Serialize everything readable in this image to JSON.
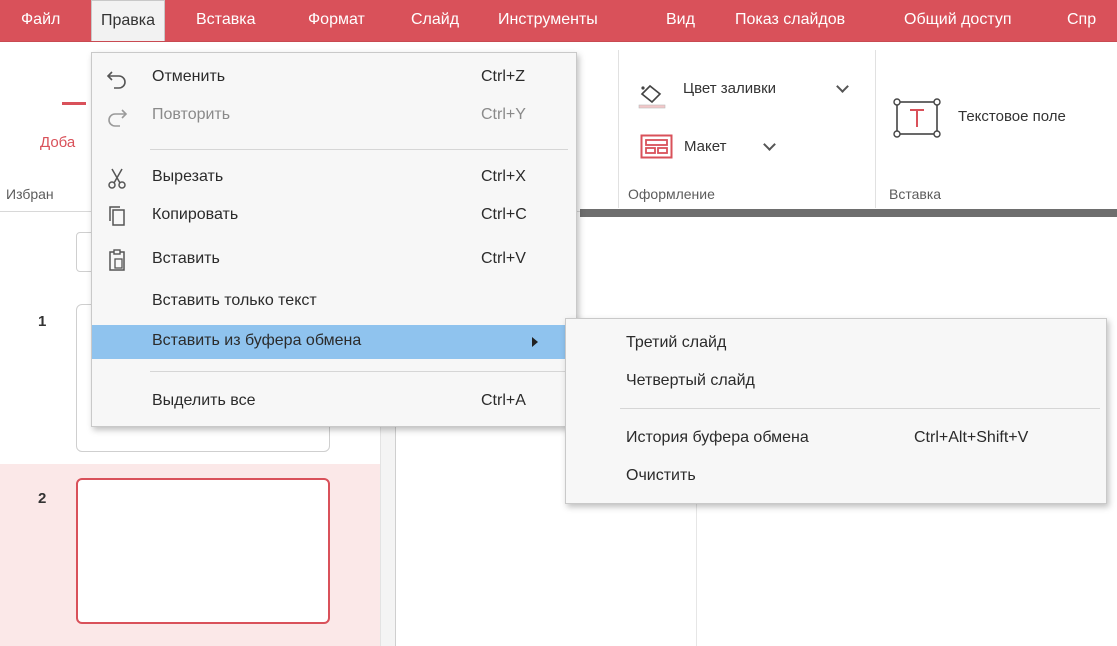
{
  "menubar": {
    "items": [
      "Файл",
      "Правка",
      "Вставка",
      "Формат",
      "Слайд",
      "Инструменты",
      "Вид",
      "Показ слайдов",
      "Общий доступ",
      "Спр"
    ],
    "active": "Правка"
  },
  "ribbon": {
    "favorites_button_label": "Доба",
    "favorites_group_label": "Избран",
    "fill_color_label": "Цвет заливки",
    "layout_label": "Макет",
    "design_group_label": "Оформление",
    "text_box_label": "Текстовое поле",
    "insert_group_label": "Вставка"
  },
  "slides": {
    "numbers": [
      "1",
      "2"
    ],
    "selected": "2"
  },
  "edit_menu": {
    "items": [
      {
        "label": "Отменить",
        "shortcut": "Ctrl+Z",
        "icon": "undo-icon"
      },
      {
        "label": "Повторить",
        "shortcut": "Ctrl+Y",
        "icon": "redo-icon"
      },
      {
        "label": "Вырезать",
        "shortcut": "Ctrl+X",
        "icon": "scissors-icon"
      },
      {
        "label": "Копировать",
        "shortcut": "Ctrl+C",
        "icon": "copy-icon"
      },
      {
        "label": "Вставить",
        "shortcut": "Ctrl+V",
        "icon": "clipboard-icon"
      },
      {
        "label": "Вставить только текст",
        "shortcut": ""
      },
      {
        "label": "Вставить из буфера обмена",
        "shortcut": ""
      },
      {
        "label": "Выделить все",
        "shortcut": "Ctrl+A"
      }
    ]
  },
  "clipboard_submenu": {
    "items": [
      {
        "label": "Третий слайд",
        "shortcut": ""
      },
      {
        "label": "Четвертый слайд",
        "shortcut": ""
      },
      {
        "label": "История буфера обмена",
        "shortcut": "Ctrl+Alt+Shift+V"
      },
      {
        "label": "Очистить",
        "shortcut": ""
      }
    ]
  },
  "colors": {
    "accent": "#d9515a",
    "menu_highlight": "#8fc3ee",
    "selected_slide_bg": "#fbe8e8"
  }
}
